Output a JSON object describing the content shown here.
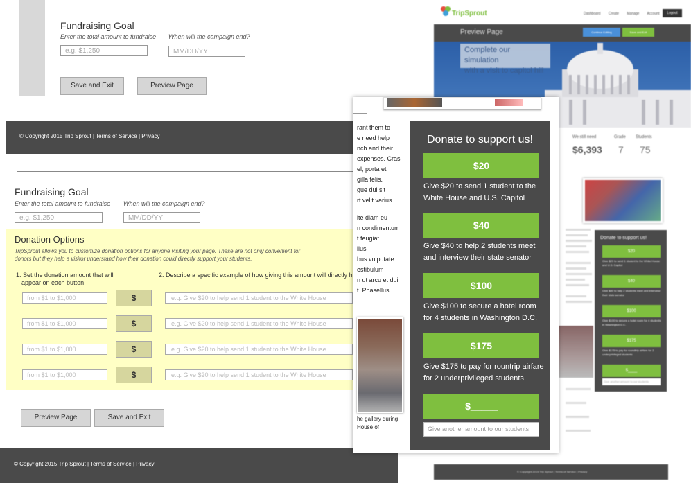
{
  "top_form": {
    "heading": "Fundraising Goal",
    "amount_label": "Enter the total amount to fundraise",
    "date_label": "When will the campaign end?",
    "amount_placeholder": "e.g. $1,250",
    "date_placeholder": "MM/DD/YY",
    "save_exit": "Save and Exit",
    "preview": "Preview Page"
  },
  "footer": {
    "copyright": "© Copyright 2015 Trip Sprout",
    "sep": "|",
    "terms": "Terms of Service",
    "privacy": "Privacy"
  },
  "mid_form": {
    "heading": "Fundraising Goal",
    "amount_label": "Enter the total amount to fundraise",
    "date_label": "When will the campaign end?",
    "amount_placeholder": "e.g. $1,250",
    "date_placeholder": "MM/DD/YY"
  },
  "donation_options": {
    "heading": "Donation Options",
    "desc_line1": "TripSprout allows you to customize donation options for anyone visiting your page. These are not only convenient for",
    "desc_line2": "donors but they help a visitor understand how their donation could directly support your students.",
    "col1_line1": "1. Set the donation amount that will",
    "col1_line2": "appear on each button",
    "col2": "2. Describe a specific example of how giving this amount will directly he",
    "rows": [
      {
        "amount": "from $1 to $1,000",
        "dollar": "$",
        "example": "e.g. Give $20 to help send 1 student to the White House"
      },
      {
        "amount": "from $1 to $1,000",
        "dollar": "$",
        "example": "e.g. Give $20 to help send 1 student to the White House"
      },
      {
        "amount": "from $1 to $1,000",
        "dollar": "$",
        "example": "e.g. Give $20 to help send 1 student to the White House"
      },
      {
        "amount": "from $1 to $1,000",
        "dollar": "$",
        "example": "e.g. Give $20 to help send 1 student to the White House"
      }
    ],
    "preview": "Preview Page",
    "save_exit": "Save and Exit"
  },
  "preview_site": {
    "logo": "TripSprout",
    "nav": [
      "Dashboard",
      "Create",
      "Manage",
      "Account"
    ],
    "logout": "Logout",
    "bar_title": "Preview Page",
    "continue_btn": "Continue Editing",
    "save_exit_btn": "Save and Exit",
    "hero_caption_line1": "Complete our simulation",
    "hero_caption_line2": "with a visit to capitol hill",
    "stats": [
      {
        "label": "We still need",
        "value": "$6,393"
      },
      {
        "label": "Grade",
        "value": "7"
      },
      {
        "label": "Students",
        "value": "75"
      }
    ],
    "mini_donate_title": "Donate to support us!",
    "mini_amounts": [
      "$20",
      "$40",
      "$100",
      "$175",
      "$____"
    ],
    "mini_descs": [
      "Give $20 to send 1 student to the White House and U.S. Capitol",
      "Give $40 to help 2 students meet and interview their state senator",
      "Give $100 to secure a hotel room for 4 students in Washington D.C.",
      "Give $175 to pay for roundtrip airfare for 2 underprivileged students"
    ],
    "mini_other_placeholder": "Give another amount to our students",
    "footer": "© Copyright 2015 Trip Sprout | Terms of Service | Privacy"
  },
  "popup": {
    "body_lines": [
      "rant them to",
      "e need help",
      "nch and their",
      "expenses. Cras",
      "el, porta et",
      "gilla felis.",
      "gue dui sit",
      "rt velit varius.",
      "",
      "ite diam eu",
      "n condimentum",
      "t feugiat",
      "llus",
      "bus vulputate",
      "estibulum",
      "n ut arcu et dui",
      "t. Phasellus"
    ],
    "caption_line1": "he gallery during",
    "caption_line2": "House of",
    "donate_title": "Donate to support us!",
    "buttons": [
      {
        "amount": "$20",
        "desc": "Give $20 to send 1 student to the White House and U.S. Capitol"
      },
      {
        "amount": "$40",
        "desc": "Give $40 to help 2 students meet and interview their state senator"
      },
      {
        "amount": "$100",
        "desc": "Give $100 to secure a hotel room for 4 students in Washington D.C."
      },
      {
        "amount": "$175",
        "desc": "Give $175 to pay for rountrip airfare for 2 underprivileged students"
      }
    ],
    "custom_amount": "$_____",
    "other_placeholder": "Give another amount to our students"
  },
  "colors": {
    "accent_green": "#7fbf3f",
    "dark_gray": "#4a4a4a",
    "yellow_bg": "#ffffc5",
    "blue_btn": "#4a90d9"
  }
}
